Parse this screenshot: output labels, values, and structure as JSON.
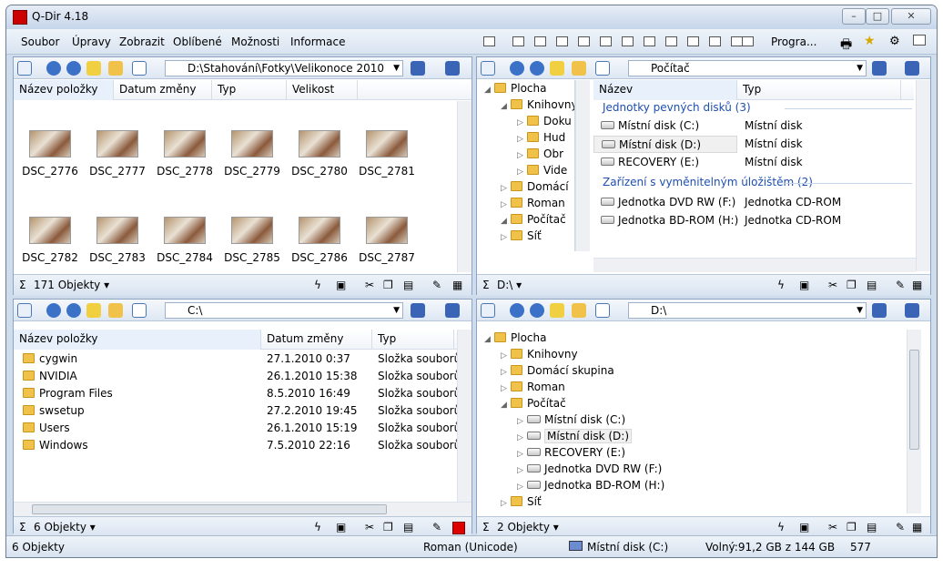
{
  "window": {
    "title": "Q-Dir 4.18",
    "min_label": "▭",
    "max_label": "□",
    "close_label": "✕"
  },
  "menu": [
    "Soubor",
    "Úpravy",
    "Zobrazit",
    "Oblíbené",
    "Možnosti",
    "Informace"
  ],
  "toolbar": {
    "programs_label": "Progra..."
  },
  "pane_tl": {
    "path": "D:\\Stahování\\Fotky\\Velikonoce 2010",
    "columns": [
      "Název položky",
      "Datum změny",
      "Typ",
      "Velikost"
    ],
    "thumbs": [
      "DSC_2776",
      "DSC_2777",
      "DSC_2778",
      "DSC_2779",
      "DSC_2780",
      "DSC_2781",
      "DSC_2782",
      "DSC_2783",
      "DSC_2784",
      "DSC_2785",
      "DSC_2786",
      "DSC_2787"
    ],
    "status": "171 Objekty ▾"
  },
  "pane_tr": {
    "tree": [
      "Plocha",
      "Knihovny",
      "Doku",
      "Hud",
      "Obr",
      "Vide",
      "Domácí",
      "Roman",
      "Počítač",
      "Síť"
    ],
    "path": "Počítač",
    "columns": [
      "Název",
      "Typ"
    ],
    "group1": "Jednotky pevných disků (3)",
    "group2": "Zařízení s vyměnitelným úložištěm (2)",
    "rows": [
      {
        "name": "Místní disk (C:)",
        "type": "Místní disk"
      },
      {
        "name": "Místní disk (D:)",
        "type": "Místní disk"
      },
      {
        "name": "RECOVERY (E:)",
        "type": "Místní disk"
      },
      {
        "name": "Jednotka DVD RW (F:)",
        "type": "Jednotka CD-ROM"
      },
      {
        "name": "Jednotka BD-ROM (H:)",
        "type": "Jednotka CD-ROM"
      }
    ],
    "status": "D:\\ ▾"
  },
  "pane_bl": {
    "path": "C:\\",
    "columns": [
      "Název položky",
      "Datum změny",
      "Typ"
    ],
    "rows": [
      {
        "name": "cygwin",
        "date": "27.1.2010 0:37",
        "type": "Složka souborů"
      },
      {
        "name": "NVIDIA",
        "date": "26.1.2010 15:38",
        "type": "Složka souborů"
      },
      {
        "name": "Program Files",
        "date": "8.5.2010 16:49",
        "type": "Složka souborů"
      },
      {
        "name": "swsetup",
        "date": "27.2.2010 19:45",
        "type": "Složka souborů"
      },
      {
        "name": "Users",
        "date": "26.1.2010 15:19",
        "type": "Složka souborů"
      },
      {
        "name": "Windows",
        "date": "7.5.2010 22:16",
        "type": "Složka souborů"
      }
    ],
    "status": "6 Objekty ▾"
  },
  "pane_br": {
    "path": "D:\\",
    "tree": [
      "Plocha",
      "Knihovny",
      "Domácí skupina",
      "Roman",
      "Počítač",
      "Místní disk (C:)",
      "Místní disk (D:)",
      "RECOVERY (E:)",
      "Jednotka DVD RW (F:)",
      "Jednotka BD-ROM (H:)",
      "Síť"
    ],
    "status": "2 Objekty ▾"
  },
  "statusbar": {
    "count": "6 Objekty",
    "encoding": "Roman (Unicode)",
    "drive": "Místní disk (C:)",
    "free": "Volný:91,2 GB z 144 GB",
    "num": "577"
  }
}
